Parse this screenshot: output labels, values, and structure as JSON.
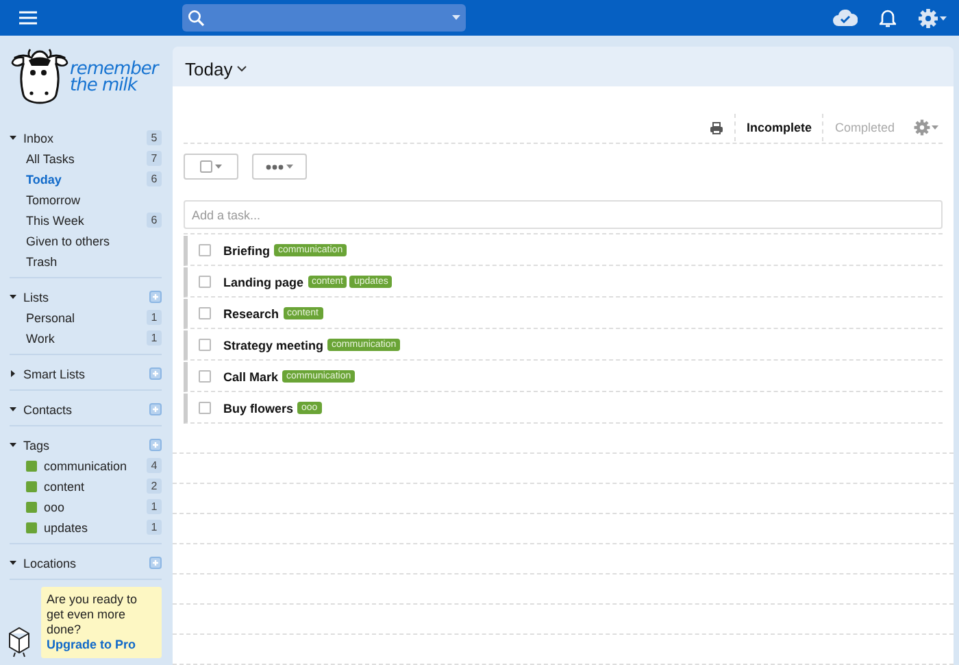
{
  "sidebar": {
    "logo": {
      "line_1": "remember",
      "line_2": "the milk"
    },
    "sections": [
      {
        "title": "Inbox",
        "expanded": true,
        "count": "5",
        "items": [
          {
            "label": "All Tasks",
            "count": "7",
            "selected": false
          },
          {
            "label": "Today",
            "count": "6",
            "selected": true
          },
          {
            "label": "Tomorrow",
            "selected": false
          },
          {
            "label": "This Week",
            "count": "6",
            "selected": false
          },
          {
            "label": "Given to others",
            "selected": false
          },
          {
            "label": "Trash",
            "selected": false
          }
        ]
      },
      {
        "title": "Lists",
        "expanded": true,
        "items": [
          {
            "label": "Personal",
            "count": "1",
            "selected": false
          },
          {
            "label": "Work",
            "count": "1",
            "selected": false
          }
        ]
      },
      {
        "title": "Smart Lists",
        "expanded": false
      },
      {
        "title": "Contacts",
        "expanded": true
      },
      {
        "title": "Tags",
        "expanded": true,
        "items": [
          {
            "label": "communication",
            "count": "4",
            "selected": false,
            "color": "#6aa436"
          },
          {
            "label": "content",
            "count": "2",
            "selected": false,
            "color": "#6aa436"
          },
          {
            "label": "ooo",
            "count": "1",
            "selected": false,
            "color": "#6aa436"
          },
          {
            "label": "updates",
            "count": "1",
            "selected": false,
            "color": "#6aa436"
          }
        ]
      },
      {
        "title": "Locations",
        "expanded": true
      }
    ],
    "promo": {
      "text": "Are you ready to get even more done?",
      "link": "Upgrade to Pro"
    }
  },
  "list_title": "Today",
  "filters": [
    {
      "label": "Incomplete",
      "selected": true
    },
    {
      "label": "Completed",
      "selected": false
    }
  ],
  "add_task": {
    "placeholder": "Add a task..."
  },
  "tasks": [
    {
      "name": "Briefing",
      "checked": false,
      "tags": [
        "communication"
      ]
    },
    {
      "name": "Landing page",
      "checked": false,
      "tags": [
        "content",
        "updates"
      ]
    },
    {
      "name": "Research",
      "checked": false,
      "tags": [
        "content"
      ]
    },
    {
      "name": "Strategy meeting",
      "checked": false,
      "tags": [
        "communication"
      ]
    },
    {
      "name": "Call Mark",
      "checked": false,
      "tags": [
        "communication"
      ]
    },
    {
      "name": "Buy flowers",
      "checked": false,
      "tags": [
        "ooo"
      ]
    }
  ]
}
